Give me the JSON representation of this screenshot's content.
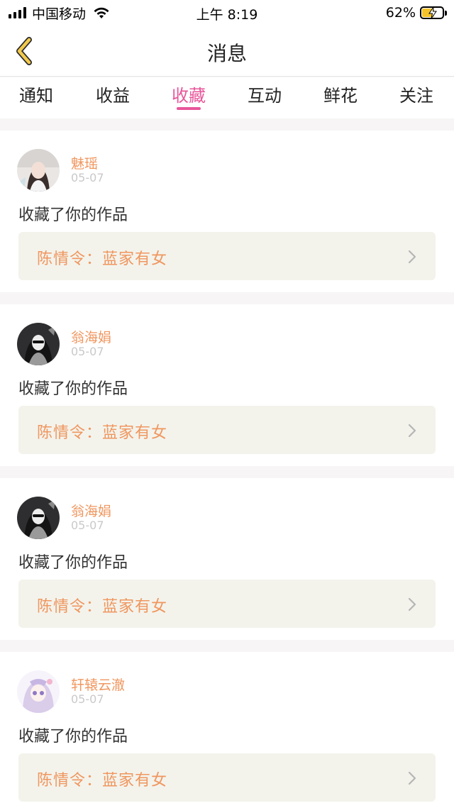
{
  "status_bar": {
    "carrier": "中国移动",
    "time": "上午 8:19",
    "battery_percent": "62%",
    "battery_level": 0.62
  },
  "nav": {
    "title": "消息"
  },
  "tabs": [
    {
      "label": "通知",
      "active": false
    },
    {
      "label": "收益",
      "active": false
    },
    {
      "label": "收藏",
      "active": true
    },
    {
      "label": "互动",
      "active": false
    },
    {
      "label": "鲜花",
      "active": false
    },
    {
      "label": "关注",
      "active": false
    }
  ],
  "messages": [
    {
      "username": "魅瑶",
      "date": "05-07",
      "action": "收藏了你的作品",
      "work": "陈情令：蓝家有女"
    },
    {
      "username": "翁海娟",
      "date": "05-07",
      "action": "收藏了你的作品",
      "work": "陈情令：蓝家有女"
    },
    {
      "username": "翁海娟",
      "date": "05-07",
      "action": "收藏了你的作品",
      "work": "陈情令：蓝家有女"
    },
    {
      "username": "轩辕云澈",
      "date": "05-07",
      "action": "收藏了你的作品",
      "work": "陈情令：蓝家有女"
    }
  ],
  "colors": {
    "accent_pink": "#e8569a",
    "username_orange": "#f0965e",
    "back_arrow_yellow": "#f2c94c"
  }
}
